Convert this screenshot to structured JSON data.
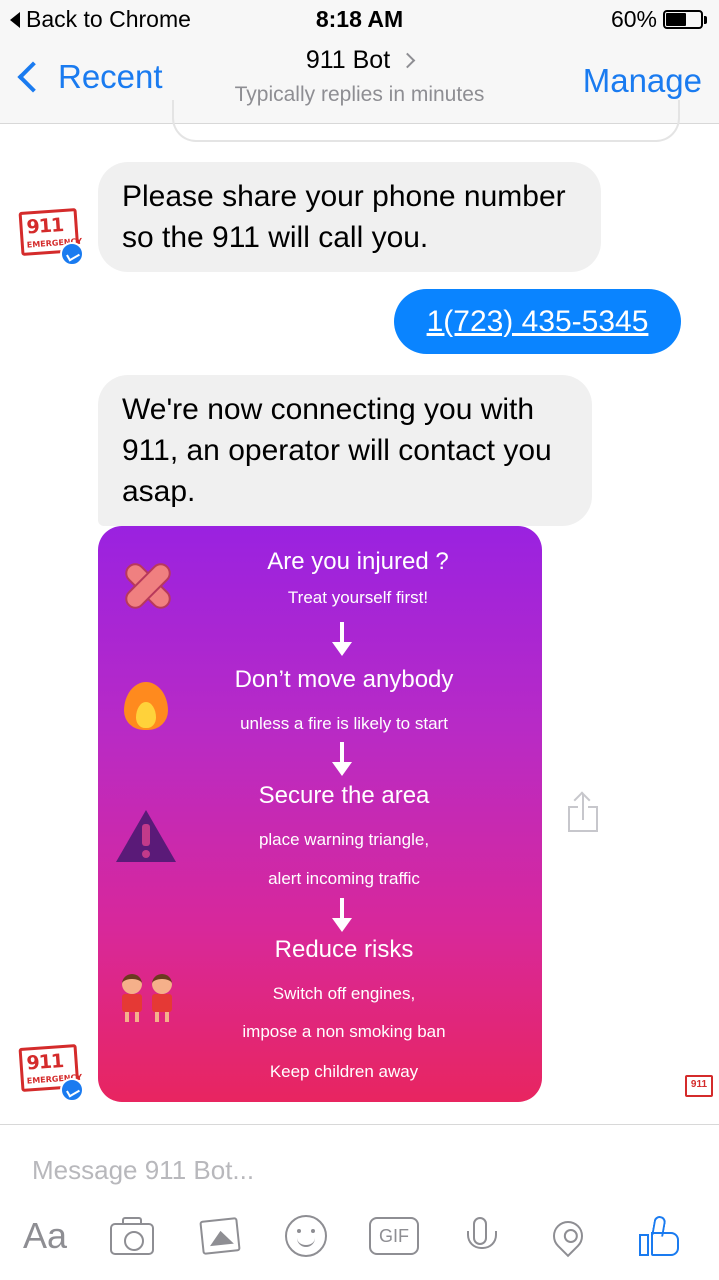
{
  "status_bar": {
    "back_label": "Back to Chrome",
    "time": "8:18 AM",
    "battery_percent": "60%",
    "battery_level": 0.6
  },
  "nav": {
    "back_label": "Recent",
    "title": "911 Bot",
    "subtitle": "Typically replies in minutes",
    "manage_label": "Manage"
  },
  "avatar": {
    "stamp_number": "911",
    "stamp_word": "EMERGENCY"
  },
  "messages": [
    {
      "from": "bot",
      "text": "Please share your phone number so the 911 will call you."
    },
    {
      "from": "user",
      "text": "1(723) 435-5345"
    },
    {
      "from": "bot",
      "text": "We're now connecting you with 911, an operator will contact you asap."
    }
  ],
  "info_card": {
    "steps": [
      {
        "icon": "bandage-icon",
        "heading": "Are you injured ?",
        "lines": [
          "Treat yourself first!"
        ]
      },
      {
        "icon": "fire-icon",
        "heading": "Don’t move anybody",
        "lines": [
          "unless a fire is likely to start"
        ]
      },
      {
        "icon": "warning-triangle-icon",
        "heading": "Secure the area",
        "lines": [
          "place warning triangle,",
          "alert incoming traffic"
        ]
      },
      {
        "icon": "children-icon",
        "heading": "Reduce risks",
        "lines": [
          "Switch off engines,",
          "impose a non smoking ban",
          "Keep children away"
        ]
      }
    ]
  },
  "composer": {
    "placeholder": "Message 911 Bot...",
    "aa_label": "Aa",
    "gif_label": "GIF"
  },
  "colors": {
    "accent": "#1a7bf0",
    "outgoing_bubble": "#0a84ff",
    "incoming_bubble": "#f0f0f0",
    "card_gradient_top": "#9a22e0",
    "card_gradient_bottom": "#e82560",
    "stamp_red": "#d42b2b"
  }
}
